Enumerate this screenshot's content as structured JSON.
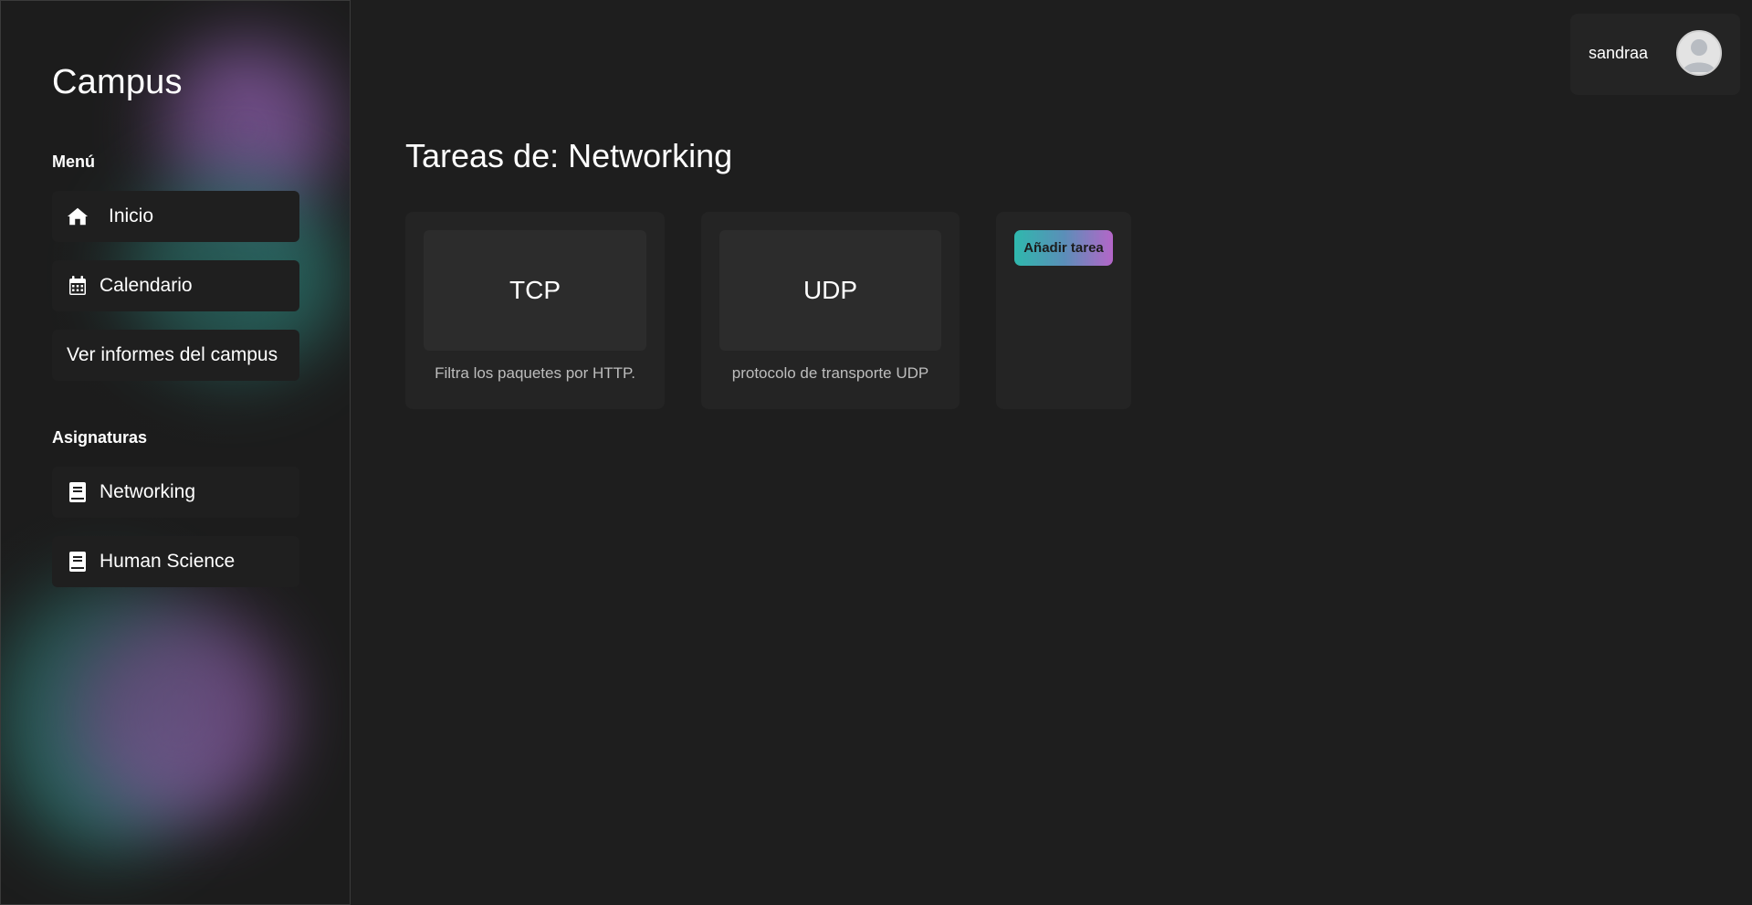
{
  "sidebar": {
    "title": "Campus",
    "menu_label": "Menú",
    "menu_items": [
      {
        "label": "Inicio",
        "icon": "home-icon"
      },
      {
        "label": "Calendario",
        "icon": "calendar-icon"
      },
      {
        "label": "Ver informes del campus"
      }
    ],
    "subjects_label": "Asignaturas",
    "subjects": [
      {
        "label": "Networking",
        "icon": "book-icon"
      },
      {
        "label": "Human Science",
        "icon": "book-icon"
      }
    ]
  },
  "header": {
    "username": "sandraa"
  },
  "main": {
    "title": "Tareas de: Networking",
    "tasks": [
      {
        "title": "TCP",
        "description": "Filtra los paquetes por HTTP."
      },
      {
        "title": "UDP",
        "description": "protocolo de transporte UDP"
      }
    ],
    "add_task_label": "Añadir tarea"
  },
  "colors": {
    "background": "#1e1e1e",
    "card": "#242424",
    "accent_teal": "#2fb8ad",
    "accent_purple": "#b466c8"
  }
}
